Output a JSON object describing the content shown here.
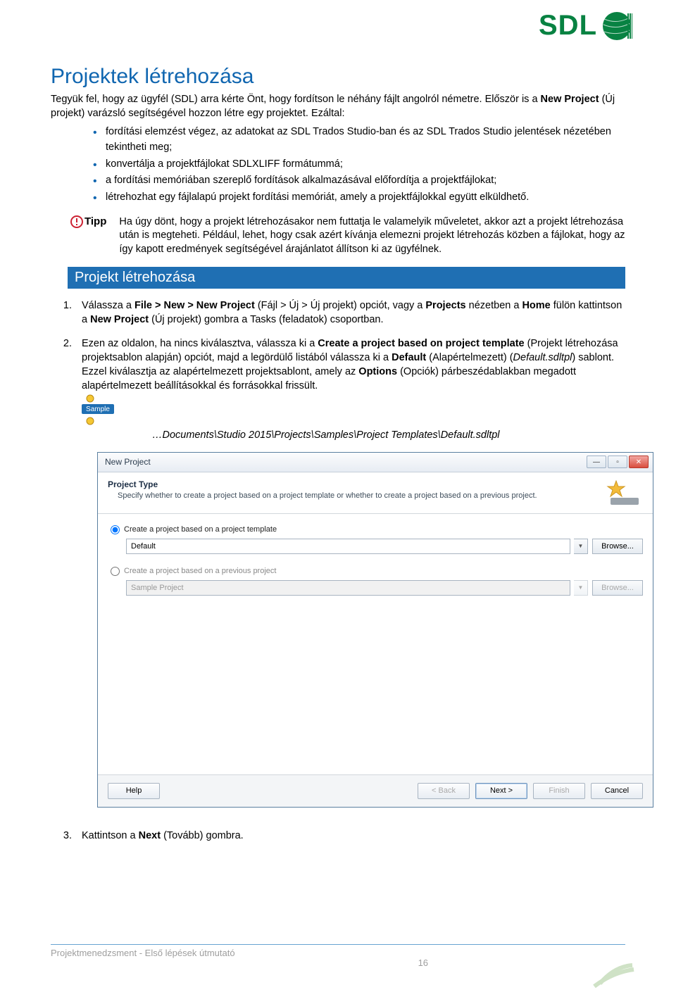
{
  "logo": {
    "text": "SDL"
  },
  "heading": "Projektek létrehozása",
  "intro1": "Tegyük fel, hogy az ügyfél (SDL) arra kérte Önt, hogy fordítson le néhány fájlt angolról németre. Először is a ",
  "intro1b": "New Project",
  "intro1c": " (Új projekt) varázsló segítségével hozzon létre egy projektet. Ezáltal:",
  "bullets": [
    "fordítási elemzést végez, az adatokat az SDL Trados Studio-ban és az SDL Trados Studio jelentések nézetében tekintheti meg;",
    "konvertálja a projektfájlokat SDLXLIFF formátummá;",
    "a fordítási memóriában szereplő fordítások alkalmazásával előfordítja a projektfájlokat;",
    "létrehozhat egy fájlalapú projekt fordítási memóriát, amely a projektfájlokkal együtt elküldhető."
  ],
  "tipLabel": "Tipp",
  "tipText": "Ha úgy dönt, hogy a projekt létrehozásakor nem futtatja le valamelyik műveletet, akkor azt a projekt létrehozása után is megteheti. Például, lehet, hogy csak azért kívánja elemezni projekt létrehozás közben a fájlokat, hogy az így kapott eredmények segítségével árajánlatot állítson ki az ügyfélnek.",
  "sectionTitle": "Projekt létrehozása",
  "step1": {
    "pre": "Válassza a ",
    "b1": "File > New > New Project",
    "mid1": " (Fájl > Új > Új projekt) opciót, vagy a ",
    "b2": "Projects",
    "mid2": " nézetben a ",
    "b3": "Home",
    "mid3": " fülön kattintson a ",
    "b4": "New Project",
    "end": " (Új projekt) gombra a Tasks (feladatok) csoportban."
  },
  "step2": {
    "pre": "Ezen az oldalon, ha nincs kiválasztva, válassza ki a ",
    "b1": "Create a project based on project template",
    "mid1": " (Projekt létrehozása projektsablon alapján) opciót, majd a legördülő listából válassza ki a ",
    "b2": "Default",
    "mid2": " (Alapértelmezett) (",
    "i1": "Default.sdltpl",
    "mid3": ") sablont. Ezzel kiválasztja az alapértelmezett projektsablont, amely az ",
    "b3": "Options",
    "end": " (Opciók) párbeszédablakban megadott alapértelmezett beállításokkal és forrásokkal frissült."
  },
  "path": "…Documents\\Studio 2015\\Projects\\Samples\\Project Templates\\Default.sdltpl",
  "dialog": {
    "title": "New Project",
    "headTitle": "Project Type",
    "headDesc": "Specify whether to create a project based on a project template or whether to create a project based on a previous project.",
    "radio1": "Create a project based on a project template",
    "combo1": "Default",
    "radio2": "Create a project based on a previous project",
    "combo2": "Sample Project",
    "browse": "Browse...",
    "help": "Help",
    "back": "< Back",
    "next": "Next >",
    "finish": "Finish",
    "cancel": "Cancel"
  },
  "step3": {
    "pre": "Kattintson a ",
    "b": "Next",
    "end": " (Tovább) gombra."
  },
  "footer": {
    "text": "Projektmenedzsment - Első lépések útmutató",
    "page": "16"
  }
}
